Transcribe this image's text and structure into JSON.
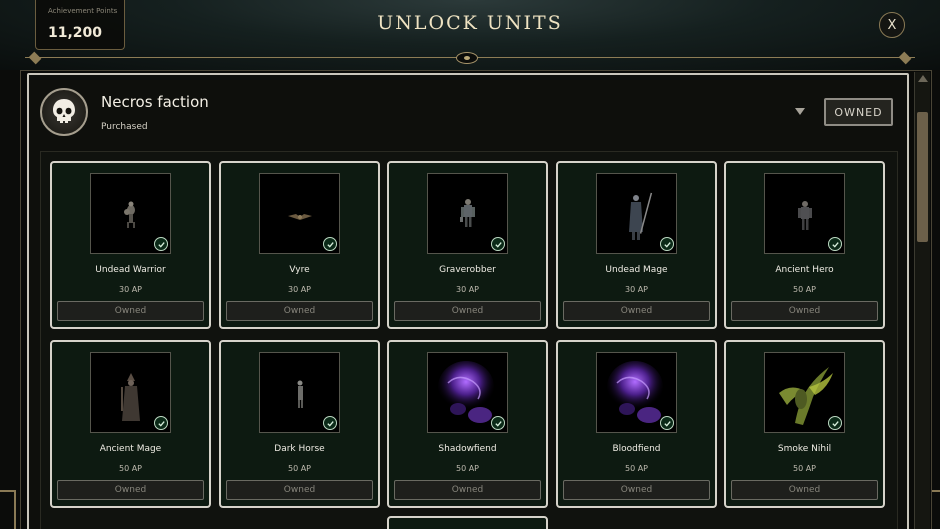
{
  "header": {
    "achievement_label": "Achievement Points",
    "achievement_value": "11,200",
    "title": "UNLOCK UNITS",
    "close_label": "X"
  },
  "faction": {
    "name": "Necros faction",
    "status": "Purchased",
    "badge": "OWNED",
    "emblem_icon": "skull-icon"
  },
  "units": [
    {
      "name": "Undead Warrior",
      "cost": "30 AP",
      "button": "Owned",
      "art": "warrior"
    },
    {
      "name": "Vyre",
      "cost": "30 AP",
      "button": "Owned",
      "art": "vyre"
    },
    {
      "name": "Graverobber",
      "cost": "30 AP",
      "button": "Owned",
      "art": "graverobber"
    },
    {
      "name": "Undead Mage",
      "cost": "30 AP",
      "button": "Owned",
      "art": "mage"
    },
    {
      "name": "Ancient Hero",
      "cost": "50 AP",
      "button": "Owned",
      "art": "hero"
    },
    {
      "name": "Ancient Mage",
      "cost": "50 AP",
      "button": "Owned",
      "art": "ancientmage"
    },
    {
      "name": "Dark Horse",
      "cost": "50 AP",
      "button": "Owned",
      "art": "horse"
    },
    {
      "name": "Shadowfiend",
      "cost": "50 AP",
      "button": "Owned",
      "art": "smoke-purple"
    },
    {
      "name": "Bloodfiend",
      "cost": "50 AP",
      "button": "Owned",
      "art": "smoke-purple"
    },
    {
      "name": "Smoke Nihil",
      "cost": "50 AP",
      "button": "Owned",
      "art": "smoke-green"
    }
  ],
  "colors": {
    "accent_gold": "#8d7c55",
    "card_border": "#d6d3ca",
    "card_bg": "#0d1a11",
    "check_green": "#bdd9c3"
  }
}
